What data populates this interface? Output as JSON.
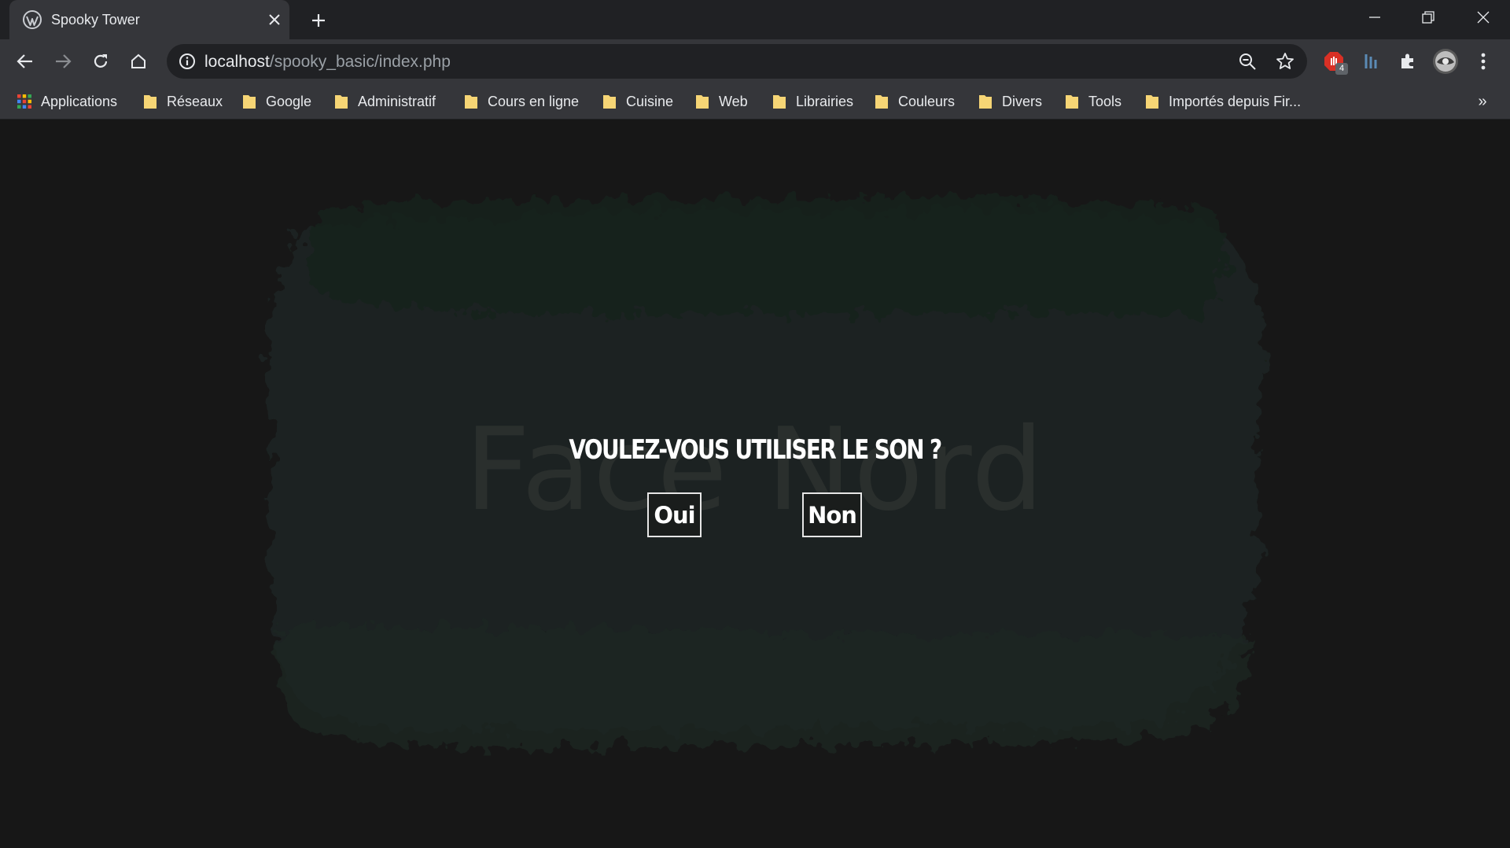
{
  "browser": {
    "tab": {
      "title": "Spooky Tower",
      "favicon": "wordpress-icon"
    },
    "address_bar": {
      "host": "localhost",
      "path": "/spooky_basic/index.php"
    },
    "extensions": [
      {
        "name": "adblock-extension-icon",
        "badge": "4",
        "color": "#d93025"
      },
      {
        "name": "bar-chart-extension-icon",
        "color": "#5b8bb5"
      },
      {
        "name": "puzzle-extensions-icon",
        "color": "#e8eaed"
      },
      {
        "name": "profile-avatar",
        "color": "#bdbdbd"
      }
    ],
    "bookmarks": [
      {
        "label": "Applications",
        "icon": "apps-grid-icon"
      },
      {
        "label": "Réseaux",
        "icon": "folder-icon"
      },
      {
        "label": "Google",
        "icon": "folder-icon"
      },
      {
        "label": "Administratif",
        "icon": "folder-icon"
      },
      {
        "label": "Cours en ligne",
        "icon": "folder-icon"
      },
      {
        "label": "Cuisine",
        "icon": "folder-icon"
      },
      {
        "label": "Web",
        "icon": "folder-icon"
      },
      {
        "label": "Librairies",
        "icon": "folder-icon"
      },
      {
        "label": "Couleurs",
        "icon": "folder-icon"
      },
      {
        "label": "Divers",
        "icon": "folder-icon"
      },
      {
        "label": "Tools",
        "icon": "folder-icon"
      },
      {
        "label": "Importés depuis Fir...",
        "icon": "folder-icon"
      }
    ],
    "bookmarks_overflow": "»"
  },
  "page": {
    "watermark": "Face Nord",
    "prompt": "VOULEZ-VOUS UTILISER LE SON ?",
    "yes_label": "Oui",
    "no_label": "Non",
    "colors": {
      "background": "#171717",
      "blob": "#1a2420",
      "watermark": "#2a2f2d",
      "text": "#ffffff",
      "folder": "#f6d575"
    }
  }
}
